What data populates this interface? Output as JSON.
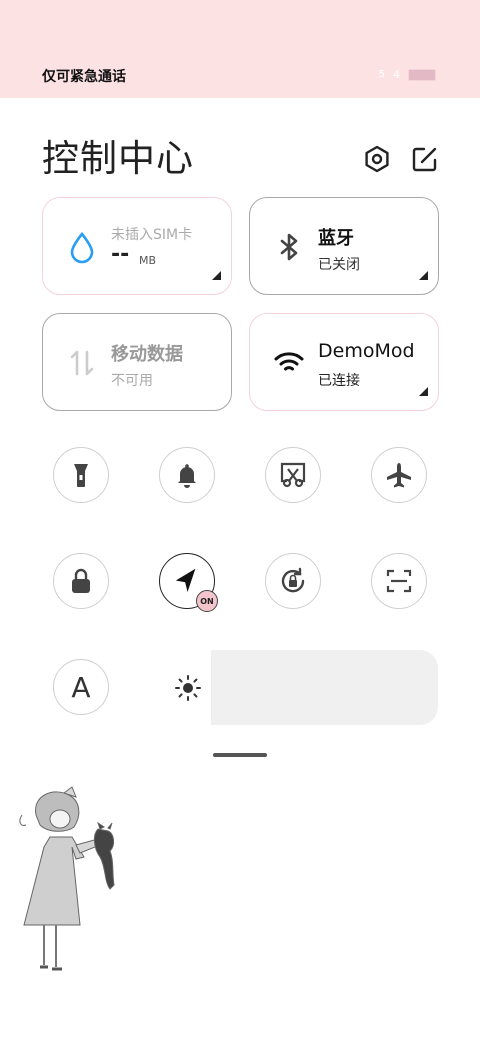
{
  "status_bar": {
    "carrier_text": "仅可紧急通话",
    "signal_1": "5",
    "signal_2": "4"
  },
  "header": {
    "title": "控制中心",
    "settings_icon": "settings-hexagon-icon",
    "edit_icon": "edit-icon"
  },
  "cards": {
    "data_usage": {
      "label": "未插入SIM卡",
      "value": "--",
      "unit": "MB"
    },
    "bluetooth": {
      "label": "蓝牙",
      "status": "已关闭"
    },
    "mobile_data": {
      "label": "移动数据",
      "status": "不可用"
    },
    "wifi": {
      "label": "DemoMod",
      "status": "已连接"
    }
  },
  "toggles": {
    "location_badge": "ON",
    "font_label": "A"
  },
  "brightness": {
    "level": 0.22
  },
  "colors": {
    "status_bg": "#fde2e4",
    "card_pink_border": "#f4d3d9",
    "accent_blue": "#2a9df4"
  }
}
